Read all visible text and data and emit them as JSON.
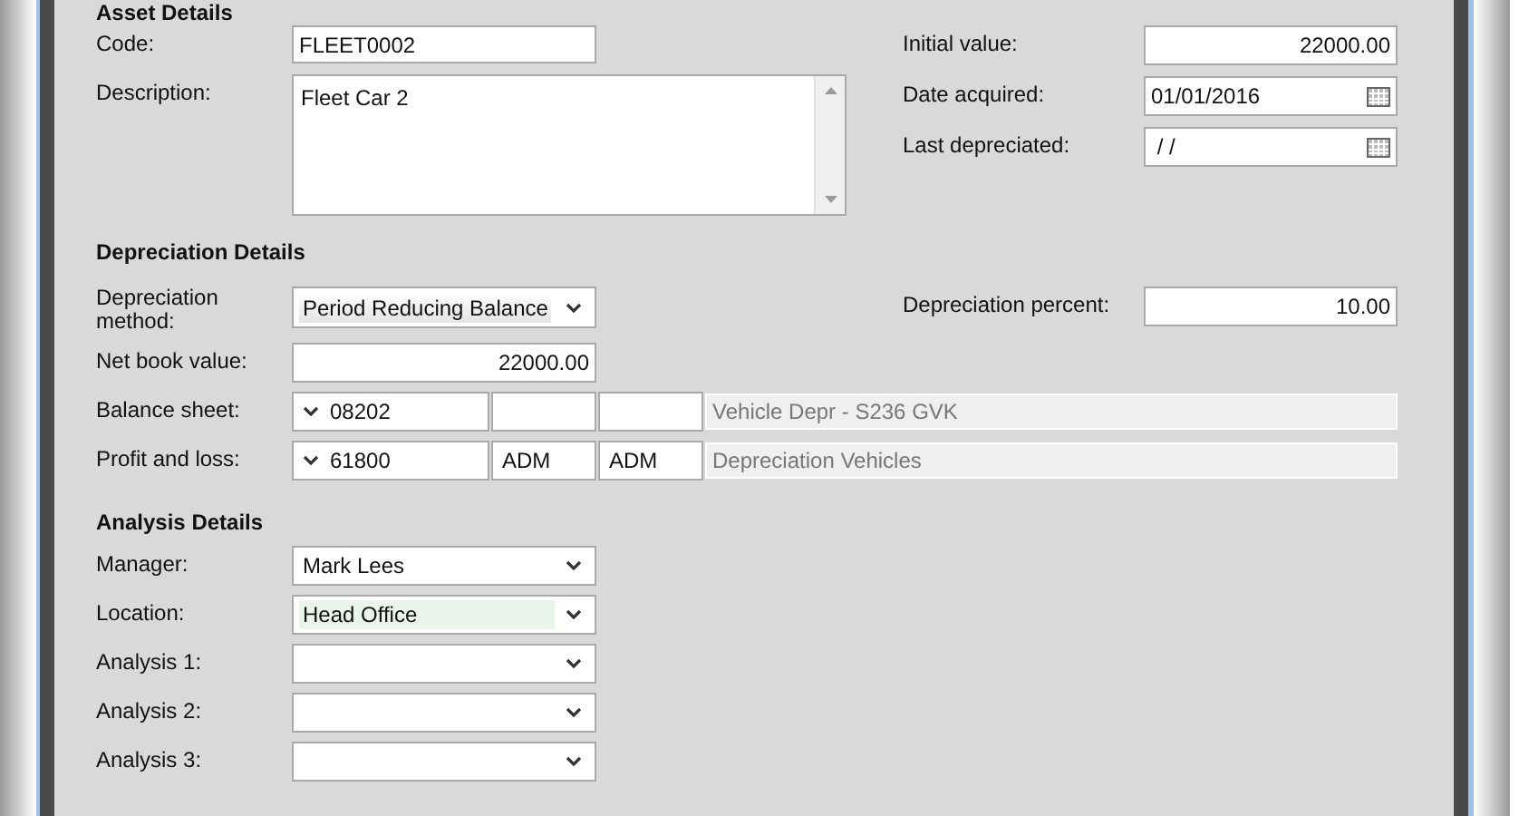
{
  "asset_details": {
    "heading": "Asset Details",
    "code": {
      "label": "Code:",
      "value": "FLEET0002"
    },
    "description": {
      "label": "Description:",
      "value": "Fleet Car 2"
    },
    "initial_value": {
      "label": "Initial value:",
      "value": "22000.00"
    },
    "date_acquired": {
      "label": "Date acquired:",
      "value": "01/01/2016"
    },
    "last_depreciated": {
      "label": "Last depreciated:",
      "value": " / /"
    }
  },
  "depreciation_details": {
    "heading": "Depreciation Details",
    "method": {
      "label": "Depreciation method:",
      "value": "Period Reducing Balance"
    },
    "net_book_value": {
      "label": "Net book value:",
      "value": "22000.00"
    },
    "percent": {
      "label": "Depreciation percent:",
      "value": "10.00"
    },
    "accounts": [
      {
        "label": "Balance sheet:",
        "code": "08202",
        "cells": [
          {},
          {}
        ],
        "description": "Vehicle Depr - S236 GVK"
      },
      {
        "label": "Profit and loss:",
        "code": "61800",
        "cells": [
          {
            "value": "ADM"
          },
          {
            "value": "ADM"
          }
        ],
        "description": "Depreciation Vehicles"
      }
    ]
  },
  "analysis_details": {
    "heading": "Analysis Details",
    "fields": [
      {
        "label": "Manager:",
        "value": "Mark Lees",
        "highlighted": false
      },
      {
        "label": "Location:",
        "value": "Head Office",
        "highlighted": true
      },
      {
        "label": "Analysis 1:",
        "highlighted": false
      },
      {
        "label": "Analysis 2:",
        "highlighted": false
      },
      {
        "label": "Analysis 3:",
        "highlighted": false
      }
    ]
  }
}
